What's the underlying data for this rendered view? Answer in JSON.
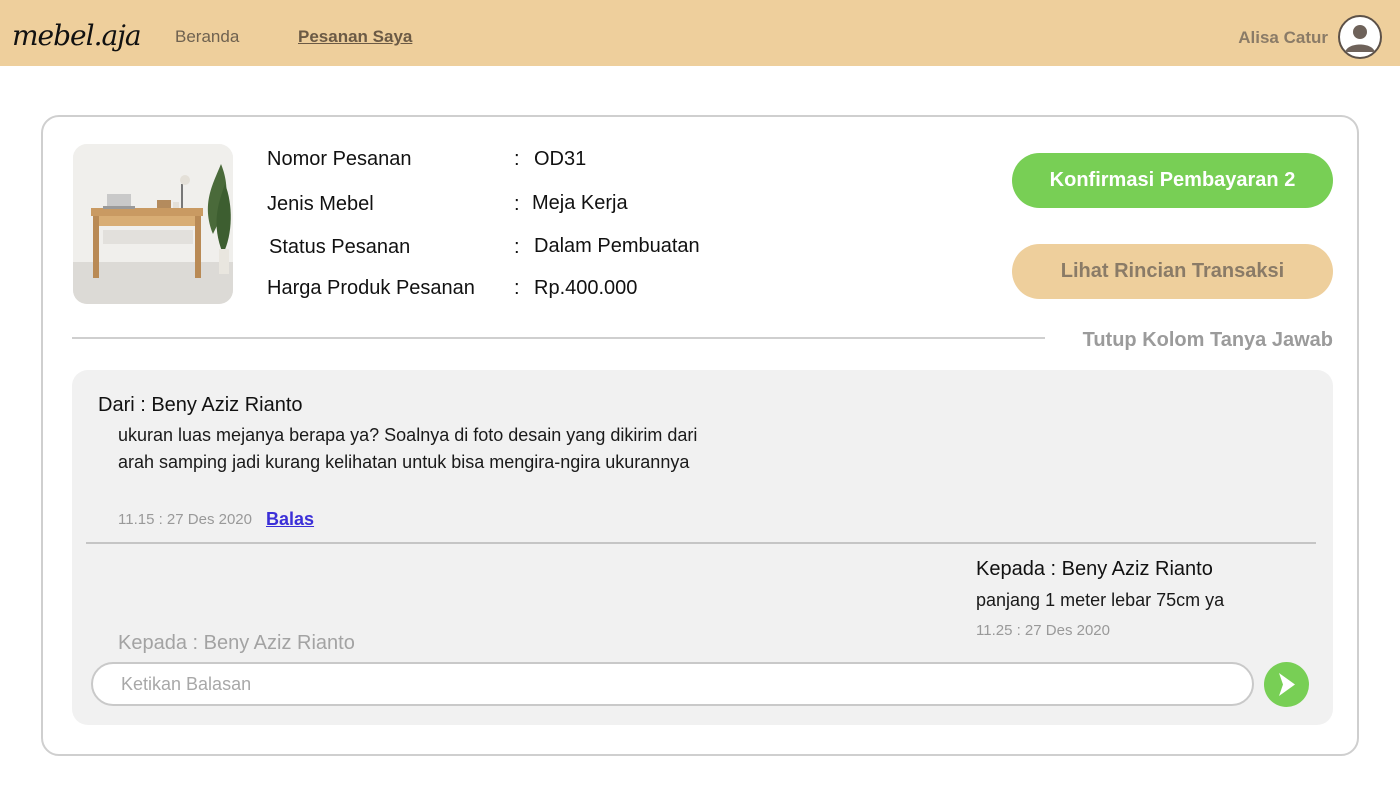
{
  "header": {
    "logo": "mebel.aja",
    "nav": {
      "home": "Beranda",
      "orders": "Pesanan Saya"
    },
    "user_name": "Alisa Catur"
  },
  "order": {
    "fields": [
      {
        "label": "Nomor Pesanan",
        "value": "OD31"
      },
      {
        "label": "Jenis Mebel",
        "value": "Meja Kerja"
      },
      {
        "label": "Status Pesanan",
        "value": "Dalam Pembuatan"
      },
      {
        "label": "Harga Produk Pesanan",
        "value": "Rp.400.000"
      }
    ],
    "separator": ":",
    "confirm_button": "Konfirmasi Pembayaran 2",
    "detail_button": "Lihat Rincian Transaksi",
    "toggle_qa": "Tutup Kolom Tanya Jawab"
  },
  "qa": {
    "question": {
      "from": "Dari : Beny Aziz Rianto",
      "body": "ukuran luas mejanya berapa ya? Soalnya di foto desain yang dikirim dari arah samping jadi kurang kelihatan untuk bisa mengira-ngira ukurannya",
      "time": "11.15 : 27 Des 2020",
      "reply_label": "Balas"
    },
    "answer": {
      "to": "Kepada : Beny Aziz Rianto",
      "body": "panjang 1 meter lebar 75cm ya",
      "time": "11.25 : 27 Des 2020"
    },
    "compose": {
      "to": "Kepada : Beny Aziz Rianto",
      "placeholder": "Ketikan Balasan"
    }
  },
  "colors": {
    "header_bg": "#eecf9c",
    "accent_green": "#78cf55",
    "link_blue": "#3b2fd8"
  },
  "icons": {
    "profile": "user-circle-icon",
    "send": "arrow-right-icon"
  }
}
